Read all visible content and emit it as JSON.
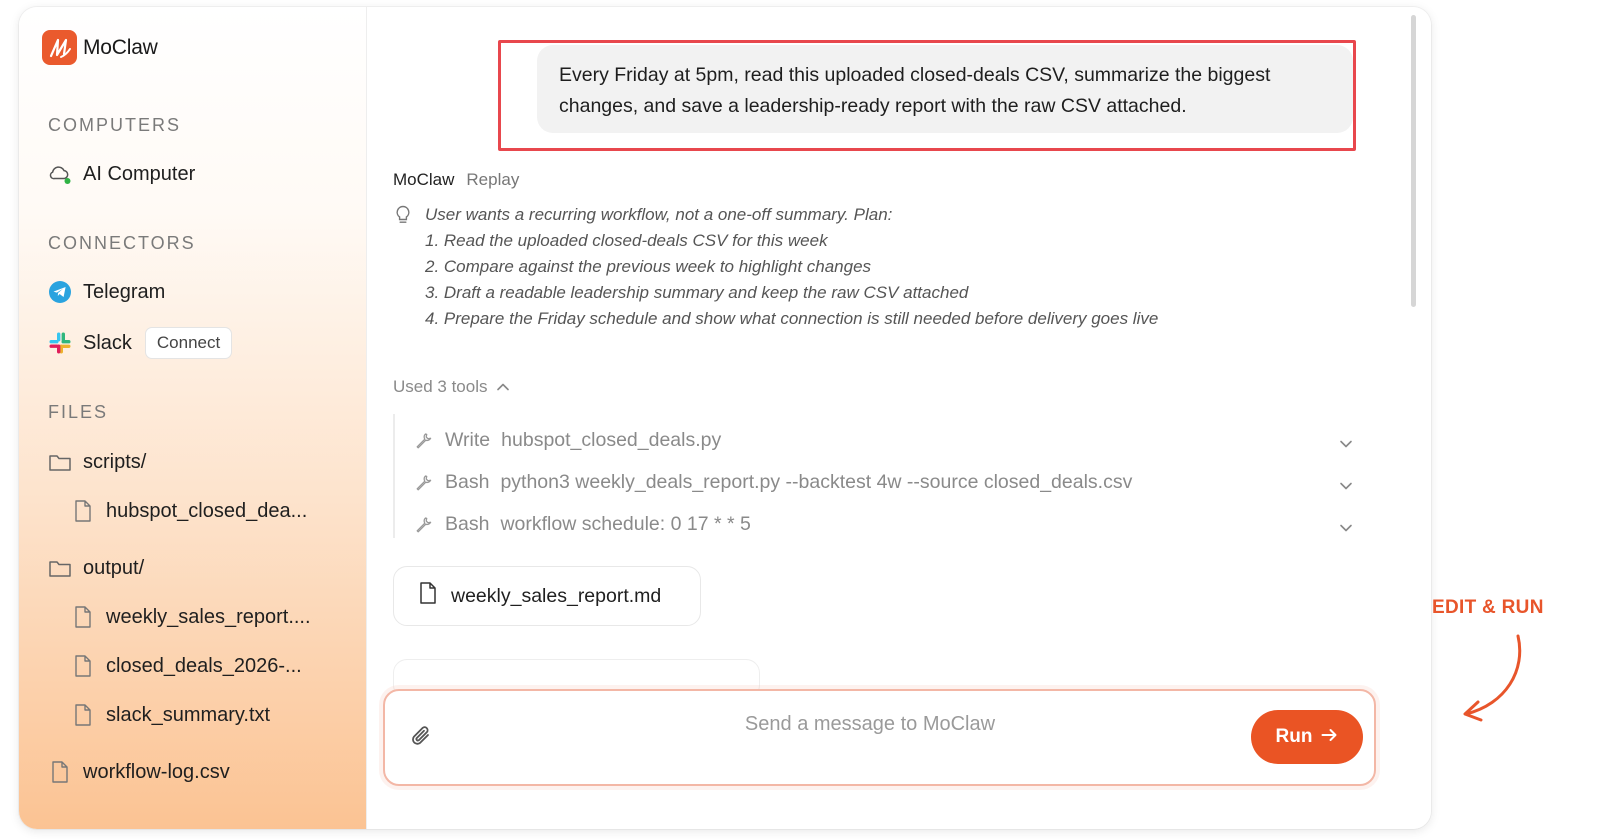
{
  "app": {
    "name": "MoClaw"
  },
  "colors": {
    "accent": "#ea5424",
    "highlight": "#e8474d",
    "annotation": "#e8552b"
  },
  "sidebar": {
    "computers_label": "COMPUTERS",
    "computers": [
      {
        "label": "AI Computer",
        "icon": "cloud-icon"
      }
    ],
    "connectors_label": "CONNECTORS",
    "connectors": [
      {
        "label": "Telegram",
        "icon": "telegram-icon"
      },
      {
        "label": "Slack",
        "icon": "slack-icon",
        "action": "Connect"
      }
    ],
    "files_label": "FILES",
    "files": [
      {
        "label": "scripts/",
        "type": "folder"
      },
      {
        "label": "hubspot_closed_dea...",
        "type": "file"
      },
      {
        "label": "output/",
        "type": "folder"
      },
      {
        "label": "weekly_sales_report....",
        "type": "file"
      },
      {
        "label": "closed_deals_2026-...",
        "type": "file"
      },
      {
        "label": "slack_summary.txt",
        "type": "file"
      },
      {
        "label": "workflow-log.csv",
        "type": "file"
      }
    ]
  },
  "chat": {
    "user_message": "Every Friday at 5pm, read this uploaded closed-deals CSV, summarize the biggest changes, and save a leadership-ready report with the raw CSV attached.",
    "agent_name": "MoClaw",
    "replay_label": "Replay",
    "plan": {
      "intro": "User wants a recurring workflow, not a one-off summary. Plan:",
      "steps": [
        "1. Read the uploaded closed-deals CSV for this week",
        "2. Compare against the previous week to highlight changes",
        "3. Draft a readable leadership summary and keep the raw CSV attached",
        "4. Prepare the Friday schedule and show what connection is still needed before delivery goes live"
      ]
    },
    "tools_toggle": "Used 3 tools",
    "tools": [
      {
        "name": "Write",
        "detail": "hubspot_closed_deals.py"
      },
      {
        "name": "Bash",
        "detail": "python3 weekly_deals_report.py --backtest 4w --source closed_deals.csv"
      },
      {
        "name": "Bash",
        "detail": "workflow schedule: 0 17 * * 5"
      }
    ],
    "attachment": "weekly_sales_report.md"
  },
  "composer": {
    "placeholder": "Send a message to MoClaw",
    "run_label": "Run"
  },
  "annotation": {
    "label": "EDIT & RUN"
  }
}
